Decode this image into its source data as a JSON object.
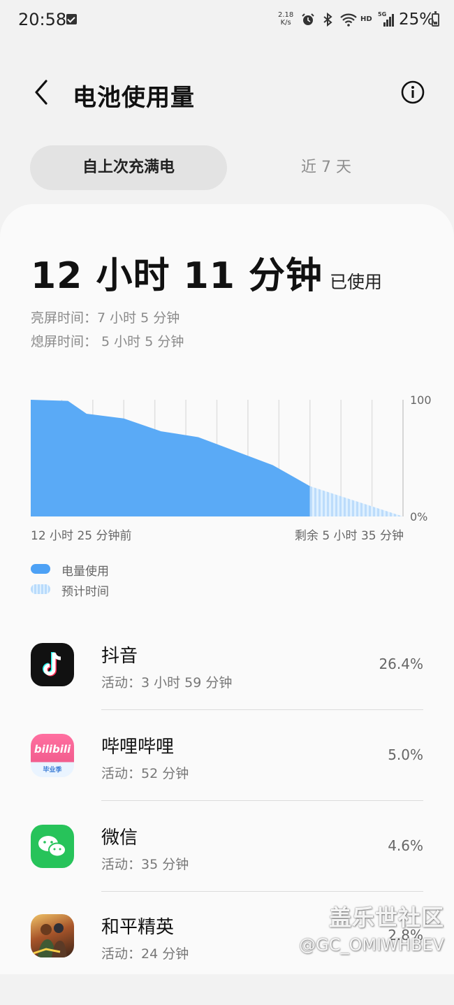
{
  "status_bar": {
    "time": "20:58",
    "net_speed_value": "2.18",
    "net_speed_unit": "K/s",
    "hd_label": "HD",
    "network_type": "5G",
    "battery_percent": "25%",
    "battery_level": 0.25,
    "icons": [
      "checkbox-icon",
      "alarm-icon",
      "bluetooth-icon",
      "wifi-icon",
      "signal-icon",
      "battery-icon"
    ]
  },
  "header": {
    "title": "电池使用量",
    "back_icon": "chevron-left-icon",
    "info_icon": "info-icon"
  },
  "tabs": [
    {
      "label": "自上次充满电",
      "active": true
    },
    {
      "label": "近 7 天",
      "active": false
    }
  ],
  "summary": {
    "total_used": "12 小时 11 分钟",
    "total_suffix": "已使用",
    "screen_on": "亮屏时间：7 小时 5 分钟",
    "screen_off": "熄屏时间： 5 小时 5 分钟"
  },
  "chart_data": {
    "type": "area",
    "yticks": [
      "100",
      "0%"
    ],
    "ylim": [
      0,
      100
    ],
    "x_start_label": "12 小时 25 分钟前",
    "x_end_label": "剩余 5 小时 35 分钟",
    "grid": true,
    "series": [
      {
        "name": "电量使用",
        "x": [
          0,
          0.1,
          0.15,
          0.25,
          0.35,
          0.45,
          0.5,
          0.6,
          0.65,
          0.7,
          0.75
        ],
        "values": [
          100,
          99,
          88,
          84,
          73,
          68,
          62,
          50,
          44,
          35,
          26
        ]
      },
      {
        "name": "预计时间",
        "x": [
          0.75,
          1.0
        ],
        "values": [
          26,
          0
        ]
      }
    ],
    "legend_placement": "bottom-left"
  },
  "legend": {
    "used_label": "电量使用",
    "estimated_label": "预计时间",
    "used_color": "#4da1f5",
    "estimated_color": "#c4e0fb"
  },
  "apps": [
    {
      "name": "抖音",
      "activity": "活动：3 小时 59 分钟",
      "percent": "26.4%",
      "icon": "douyin-icon"
    },
    {
      "name": "哔哩哔哩",
      "activity": "活动：52 分钟",
      "percent": "5.0%",
      "icon": "bilibili-icon",
      "icon_text": "bilibili",
      "icon_subtext": "毕业季"
    },
    {
      "name": "微信",
      "activity": "活动：35 分钟",
      "percent": "4.6%",
      "icon": "wechat-icon"
    },
    {
      "name": "和平精英",
      "activity": "活动：24 分钟",
      "percent": "2.8%",
      "icon": "peacekeeper-elite-icon"
    }
  ],
  "watermark": {
    "line1": "盖乐世社区",
    "line2": "@GC_OMIWHBEV"
  }
}
